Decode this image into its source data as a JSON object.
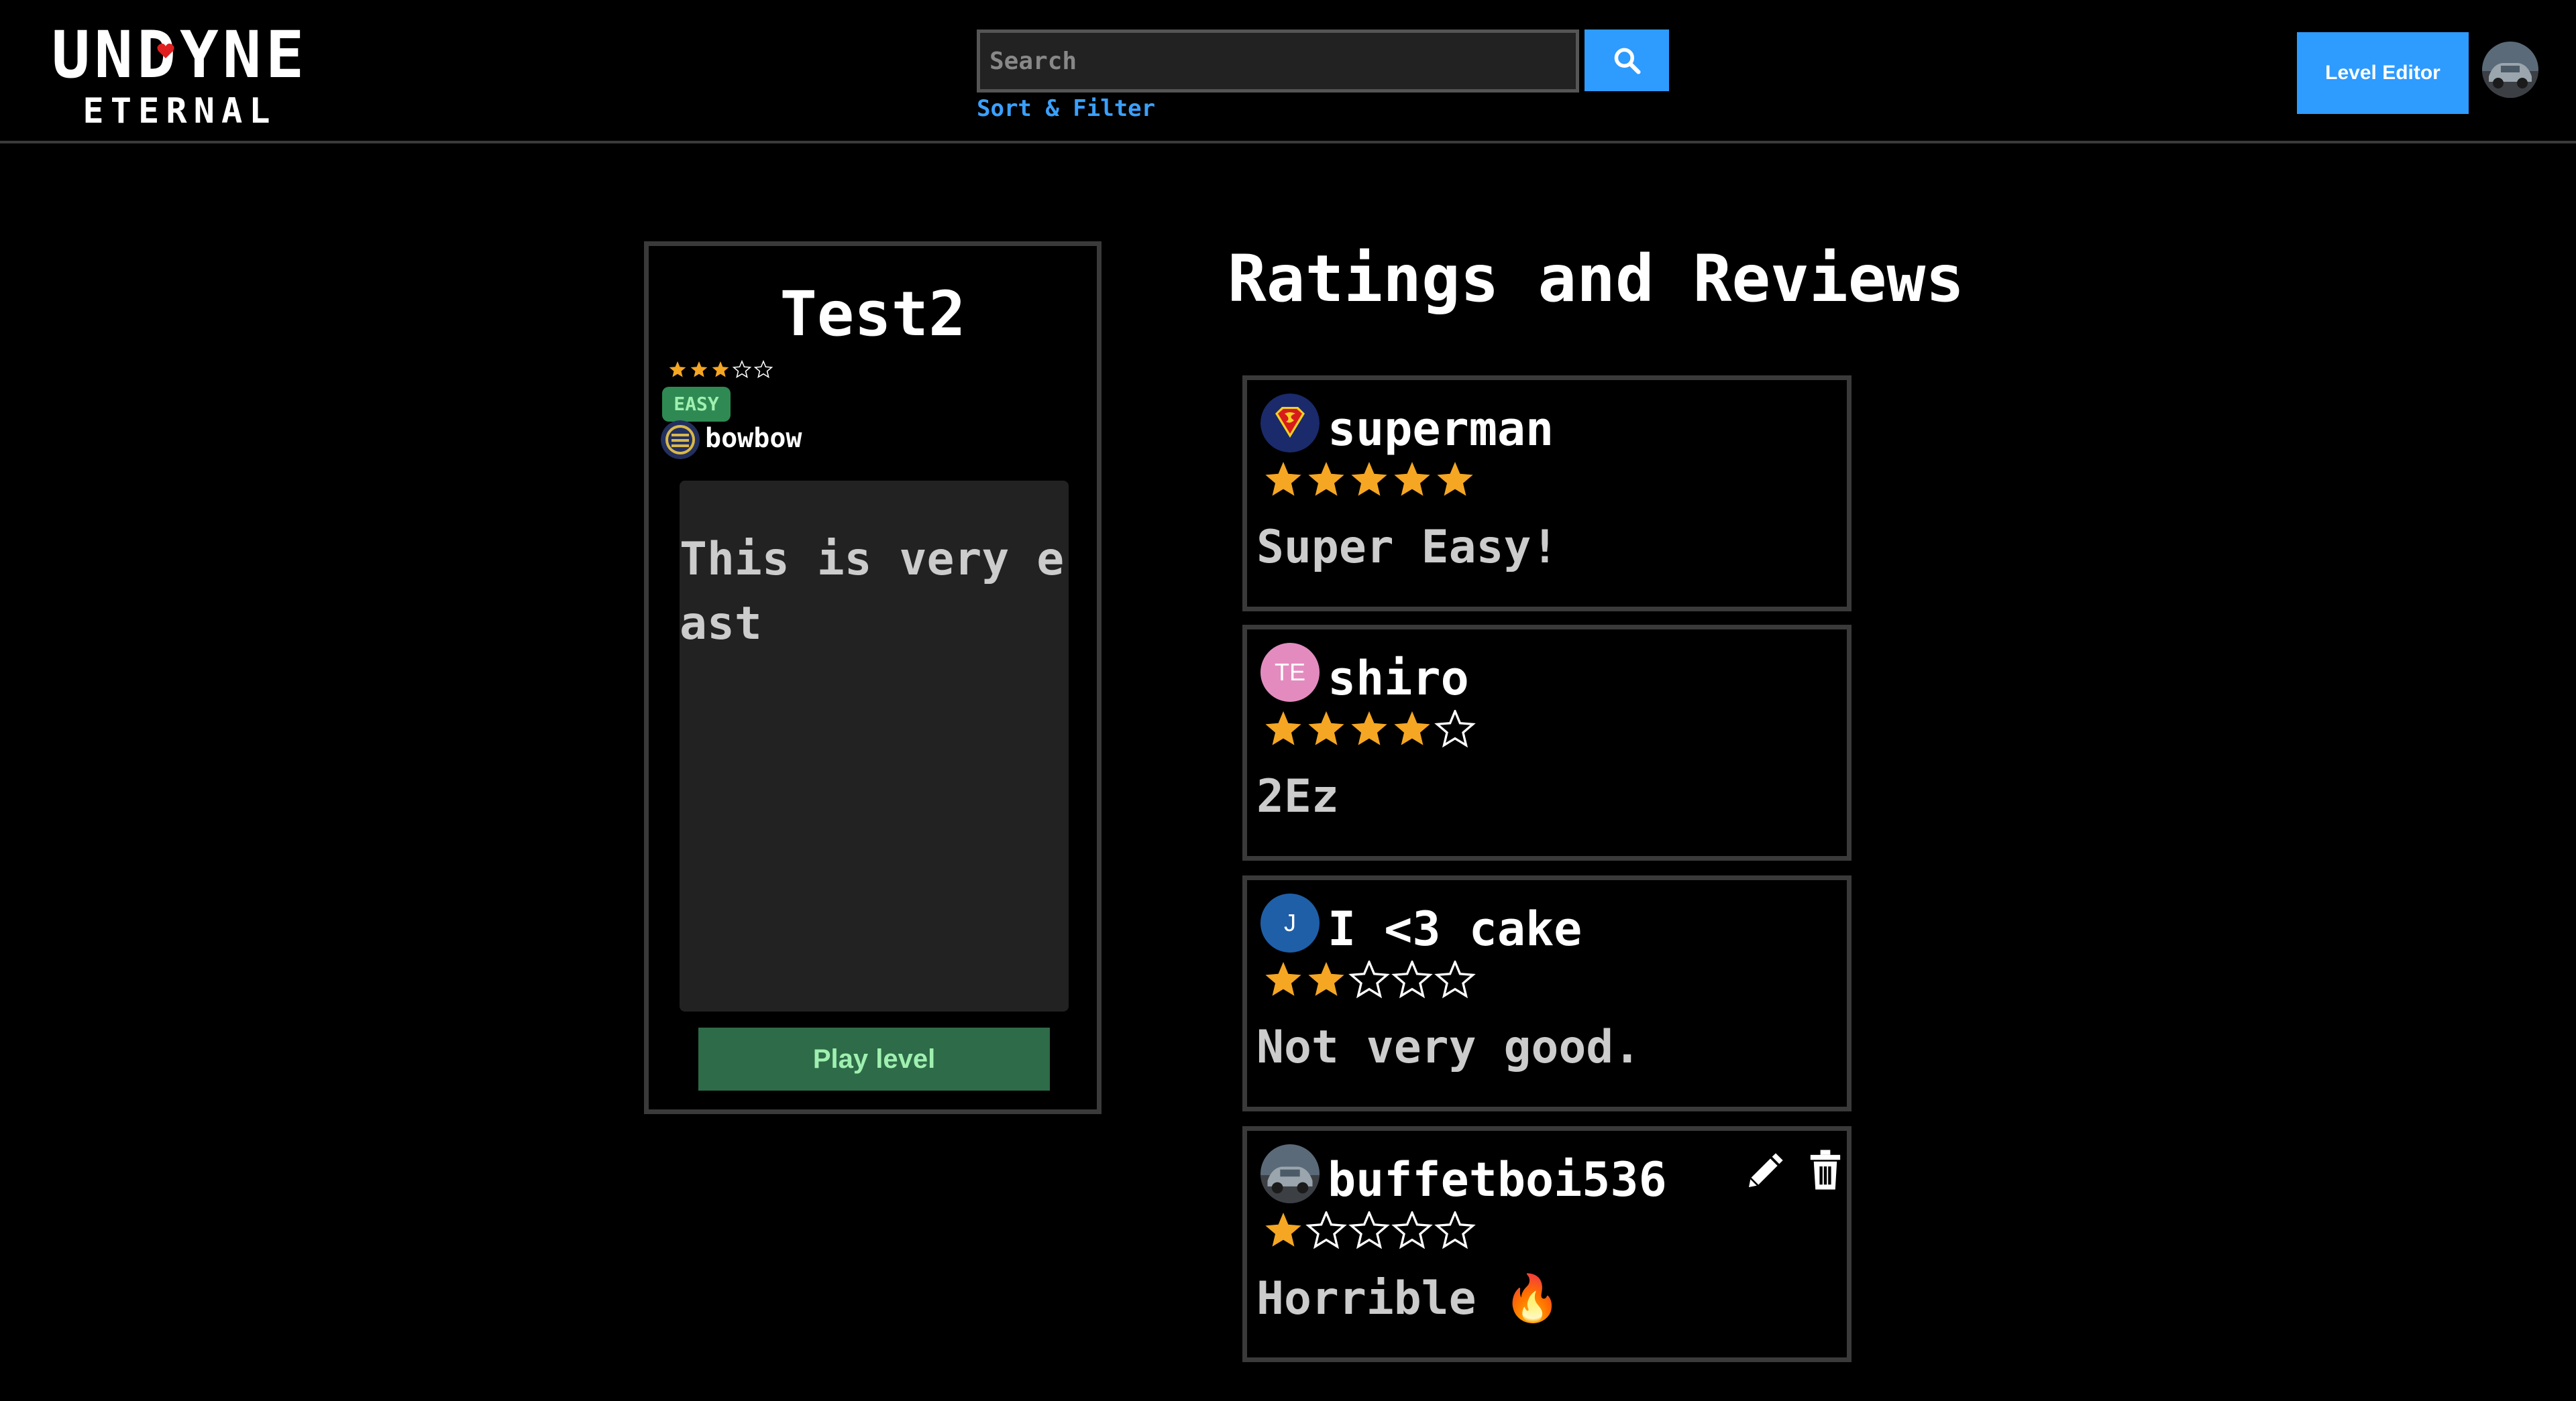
{
  "header": {
    "logo_top": "UNDYNE",
    "logo_bottom": "ETERNAL",
    "search_placeholder": "Search",
    "sort_filter": "Sort & Filter",
    "level_editor": "Level Editor"
  },
  "level": {
    "title": "Test2",
    "rating": 3,
    "max_rating": 5,
    "difficulty": "EASY",
    "author": "bowbow",
    "description": "This is very east",
    "play_button": "Play level"
  },
  "reviews_heading": "Ratings and Reviews",
  "reviews": [
    {
      "user": "superman",
      "avatar_icon": "superman-logo-icon",
      "rating": 5,
      "text": "Super Easy!"
    },
    {
      "user": "shiro",
      "avatar_initials": "TE",
      "avatar_color": "#e38bbf",
      "rating": 4,
      "text": "2Ez"
    },
    {
      "user": "I <3 cake",
      "avatar_initials": "J",
      "avatar_color": "#1f5fa8",
      "rating": 2,
      "text": "Not very good."
    },
    {
      "user": "buffetboi536",
      "avatar_icon": "car-photo-icon",
      "rating": 1,
      "text": "Horrible 🔥",
      "editable": true
    }
  ],
  "colors": {
    "accent_blue": "#2e9bff",
    "star_filled": "#f5a623",
    "star_empty": "#ffffff",
    "easy_badge": "#2e8a52",
    "play_button": "#2e6b48"
  }
}
